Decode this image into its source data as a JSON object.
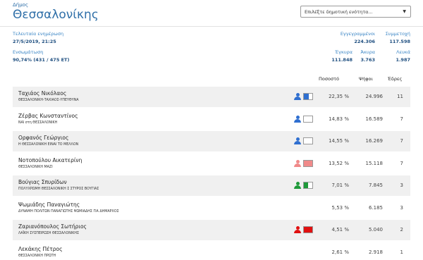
{
  "header": {
    "municipality_label": "Δήμος",
    "city": "Θεσσαλονίκης",
    "select_placeholder": "Επιλέξτε δημοτική ενότητα..."
  },
  "info": {
    "last_update_label": "Τελευταία ενημέρωση",
    "last_update_value": "27/5/2019, 21:25",
    "counted_label": "Ενσωμάτωση",
    "counted_value": "90,74% (431 / 475 ΕΤ)",
    "registered_label": "Εγγεγραμμένοι",
    "registered_value": "224.306",
    "turnout_label": "Συμμετοχή",
    "turnout_value": "117.598",
    "valid_label": "Έγκυρα",
    "valid_value": "111.848",
    "invalid_label": "Άκυρα",
    "invalid_value": "3.763",
    "blank_label": "Λευκά",
    "blank_value": "1.987"
  },
  "table": {
    "headers": {
      "percent": "Ποσοστό",
      "votes": "Ψήφοι",
      "seats": "Έδρες"
    },
    "rows": [
      {
        "candidate": "Ταχιάος Νικόλαος",
        "party": "ΘΕΣΣΑΛΟΝΙΚΗ-ΤΑΧΙΑΟΣ-ΥΠΕΥΘΥΝΑ",
        "percent": "22,35 %",
        "votes": "24.996",
        "seats": "11",
        "person_color": "#2f6fd0",
        "flag_color": "#2f6fd0",
        "flag_fill": 0.55,
        "has_icon": true
      },
      {
        "candidate": "Ζέρβας Κωνσταντίνος",
        "party": "ΝΑΙ στη ΘΕΣΣΑΛΟΝΙΚΗ",
        "percent": "14,83 %",
        "votes": "16.589",
        "seats": "7",
        "person_color": "#2f6fd0",
        "flag_color": "#ffffff",
        "flag_fill": 0,
        "has_icon": true
      },
      {
        "candidate": "Ορφανός Γεώργιος",
        "party": "Η ΘΕΣΣΑΛΟΝΙΚΗ ΕΙΝΑΙ ΤΟ ΜΕΛΛΟΝ",
        "percent": "14,55 %",
        "votes": "16.269",
        "seats": "7",
        "person_color": "#2f6fd0",
        "flag_color": "#ffffff",
        "flag_fill": 0,
        "has_icon": true
      },
      {
        "candidate": "Νοτοπούλου Αικατερίνη",
        "party": "ΘΕΣΣΑΛΟΝΙΚΗ ΜΑΖΙ",
        "percent": "13,52 %",
        "votes": "15.118",
        "seats": "7",
        "person_color": "#f08a8a",
        "flag_color": "#f08a8a",
        "flag_fill": 1,
        "has_icon": true
      },
      {
        "candidate": "Βούγιας Σπυρίδων",
        "party": "ΠΟΛΥΧΡΩΜΗ ΘΕΣΣΑΛΟΝΙΚΗ Σ ΣΤΥΡΟΣ ΒΟΥΓΙΑΣ",
        "percent": "7,01 %",
        "votes": "7.845",
        "seats": "3",
        "person_color": "#1f9a3a",
        "flag_color": "#1f9a3a",
        "flag_fill": 0.5,
        "has_icon": true
      },
      {
        "candidate": "Ψωμιάδης Παναγιώτης",
        "party": "ΔΥΝΑΜΗ ΠΟΛΙΤΩΝ ΠΑΝΑΓΙΩΤΗΣ ΨΩΜΙΑΔΗΣ ΓΙΑ ΔΗΜΑΡΧΟΣ",
        "percent": "5,53 %",
        "votes": "6.185",
        "seats": "3",
        "person_color": "#cccccc",
        "flag_color": "#cccccc",
        "flag_fill": 0,
        "has_icon": false
      },
      {
        "candidate": "Ζαριανόπουλος Σωτήριος",
        "party": "ΛΑΪΚΗ ΣΥΣΠΕΙΡΩΣΗ ΘΕΣΣΑΛΟΝΙΚΗΣ",
        "percent": "4,51 %",
        "votes": "5.040",
        "seats": "2",
        "person_color": "#e01010",
        "flag_color": "#e01010",
        "flag_fill": 1,
        "has_icon": true
      },
      {
        "candidate": "Λεκάκης Πέτρος",
        "party": "ΘΕΣΣΑΛΟΝΙΚΗ ΠΡΩΤΗ",
        "percent": "2,61 %",
        "votes": "2.918",
        "seats": "1",
        "person_color": "#cccccc",
        "flag_color": "#cccccc",
        "flag_fill": 0,
        "has_icon": false
      }
    ]
  }
}
